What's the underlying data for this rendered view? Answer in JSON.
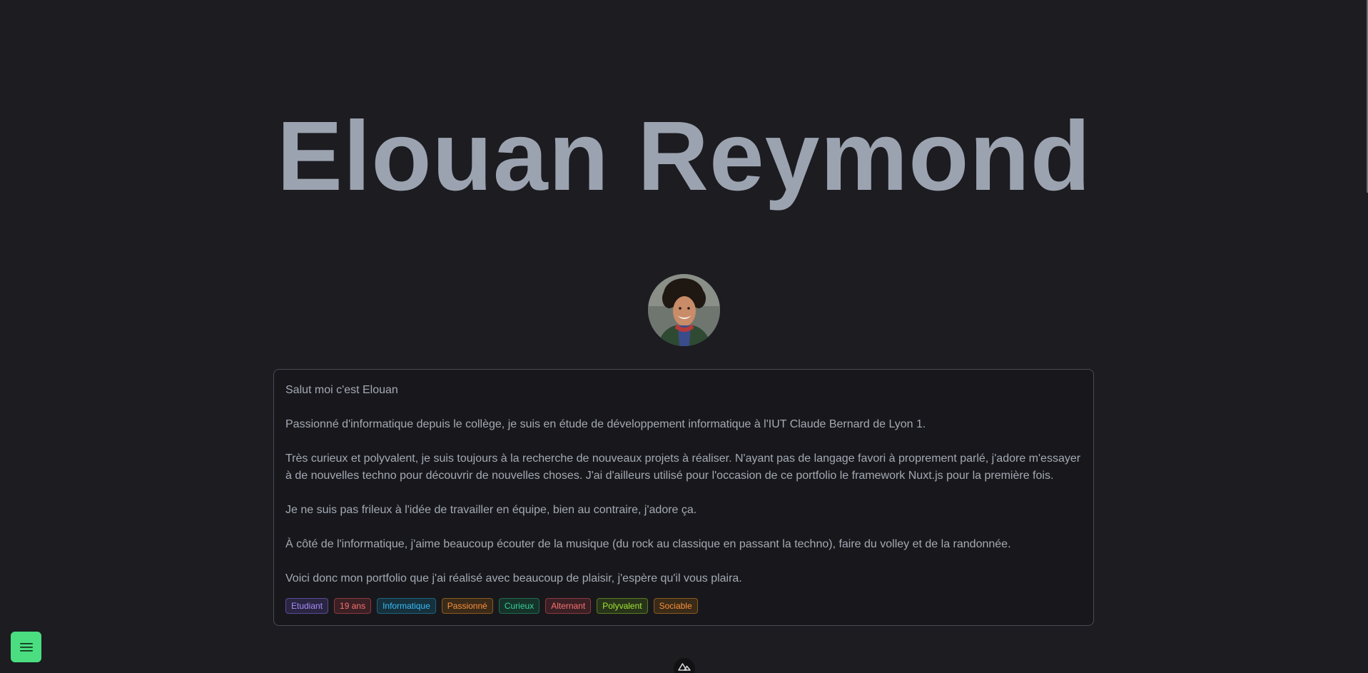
{
  "hero": {
    "name": "Elouan Reymond"
  },
  "avatar": {
    "alt": "Photo de Elouan"
  },
  "about": {
    "paragraphs": [
      "Salut moi c'est Elouan",
      "Passionné d'informatique depuis le collège, je suis en étude de développement informatique à l'IUT Claude Bernard de Lyon 1.",
      "Très curieux et polyvalent, je suis toujours à la recherche de nouveaux projets à réaliser. N'ayant pas de langage favori à proprement parlé, j'adore m'essayer à de nouvelles techno pour découvrir de nouvelles choses. J'ai d'ailleurs utilisé pour l'occasion de ce portfolio le framework Nuxt.js pour la première fois.",
      "Je ne suis pas frileux à l'idée de travailler en équipe, bien au contraire, j'adore ça.",
      "À côté de l'informatique, j'aime beaucoup écouter de la musique (du rock au classique en passant la techno), faire du volley et de la randonnée.",
      "Voici donc mon portfolio que j'ai réalisé avec beaucoup de plaisir, j'espère qu'il vous plaira."
    ],
    "tags": [
      {
        "label": "Etudiant",
        "color": "#a78bfa",
        "bg": "#2a2540",
        "border": "#5b4a9a"
      },
      {
        "label": "19 ans",
        "color": "#f87171",
        "bg": "#3a2024",
        "border": "#8a3a3e"
      },
      {
        "label": "Informatique",
        "color": "#38bdf8",
        "bg": "#16303c",
        "border": "#1f6480"
      },
      {
        "label": "Passionné",
        "color": "#fb923c",
        "bg": "#3a2a18",
        "border": "#8a5a22"
      },
      {
        "label": "Curieux",
        "color": "#34d399",
        "bg": "#16332a",
        "border": "#1f6a50"
      },
      {
        "label": "Alternant",
        "color": "#f87171",
        "bg": "#3a2024",
        "border": "#8a3a3e"
      },
      {
        "label": "Polyvalent",
        "color": "#a3e635",
        "bg": "#28341a",
        "border": "#5a7a22"
      },
      {
        "label": "Sociable",
        "color": "#fb923c",
        "bg": "#3a2a18",
        "border": "#8a5a22"
      }
    ]
  },
  "menu": {
    "icon": "hamburger-menu-icon",
    "color": "#4ade80"
  },
  "footer": {
    "icon": "nuxt-logo-icon"
  }
}
